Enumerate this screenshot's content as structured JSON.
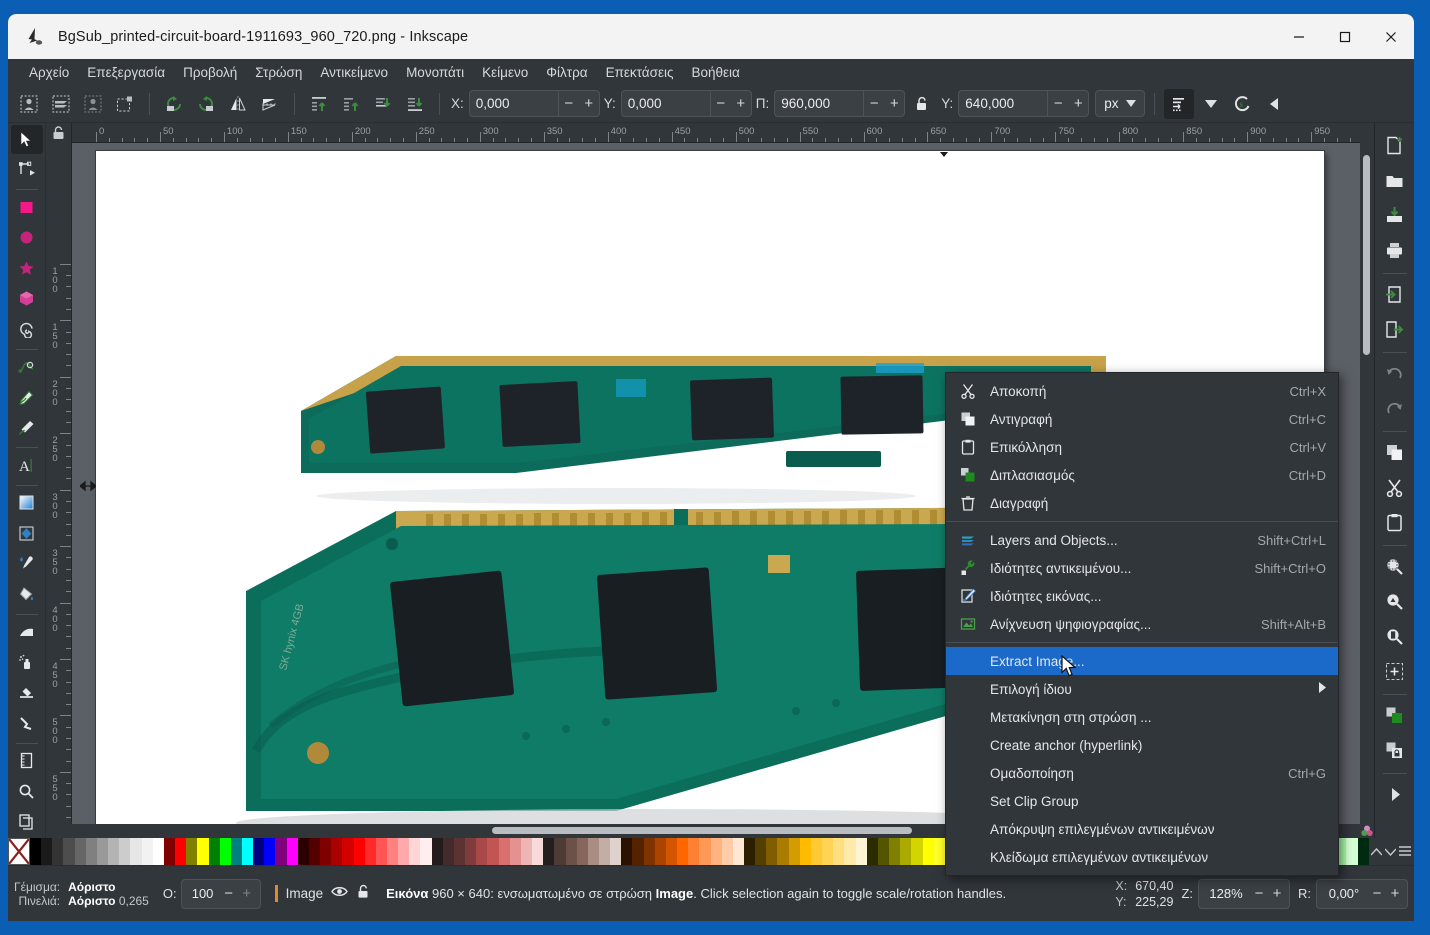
{
  "window": {
    "title": "BgSub_printed-circuit-board-1911693_960_720.png - Inkscape",
    "app_icon": "inkscape-icon",
    "minimize_label": "─",
    "maximize_label": "□",
    "close_label": "✕"
  },
  "menubar": {
    "items": [
      {
        "label": "Αρχείο",
        "name": "menu-file"
      },
      {
        "label": "Επεξεργασία",
        "name": "menu-edit"
      },
      {
        "label": "Προβολή",
        "name": "menu-view"
      },
      {
        "label": "Στρώση",
        "name": "menu-layer"
      },
      {
        "label": "Αντικείμενο",
        "name": "menu-object"
      },
      {
        "label": "Μονοπάτι",
        "name": "menu-path"
      },
      {
        "label": "Κείμενο",
        "name": "menu-text"
      },
      {
        "label": "Φίλτρα",
        "name": "menu-filters"
      },
      {
        "label": "Επεκτάσεις",
        "name": "menu-extensions"
      },
      {
        "label": "Βοήθεια",
        "name": "menu-help"
      }
    ]
  },
  "toolbar": {
    "select_all_label": "select-all-in-all-layers",
    "fields": [
      {
        "label": "X:",
        "value": "0,000",
        "name": "x-field"
      },
      {
        "label": "Y:",
        "value": "0,000",
        "name": "y-field"
      },
      {
        "label": "Π:",
        "value": "960,000",
        "name": "width-field"
      },
      {
        "label": "Y:",
        "value": "640,000",
        "name": "height-field"
      }
    ],
    "unit": "px",
    "minus": "−",
    "plus": "+"
  },
  "rulers": {
    "horizontal_ticks": [
      "0",
      "50",
      "100",
      "150",
      "200",
      "250",
      "300",
      "350",
      "400",
      "450",
      "500",
      "550",
      "600",
      "650",
      "700",
      "750",
      "800",
      "850",
      "900",
      "950"
    ],
    "vertical_ticks": [
      "100",
      "150",
      "200",
      "250",
      "300",
      "350",
      "400",
      "450",
      "500",
      "550"
    ]
  },
  "context_menu": {
    "items": [
      {
        "label": "Αποκοπή",
        "accel": "Ctrl+X",
        "icon": "scissors-icon",
        "name": "ctx-cut"
      },
      {
        "label": "Αντιγραφή",
        "accel": "Ctrl+C",
        "icon": "copy-icon",
        "name": "ctx-copy"
      },
      {
        "label": "Επικόλληση",
        "accel": "Ctrl+V",
        "icon": "clipboard-icon",
        "name": "ctx-paste"
      },
      {
        "label": "Διπλασιασμός",
        "accel": "Ctrl+D",
        "icon": "duplicate-icon",
        "name": "ctx-duplicate"
      },
      {
        "label": "Διαγραφή",
        "accel": "",
        "icon": "trash-icon",
        "name": "ctx-delete"
      },
      {
        "label": "Layers and Objects...",
        "accel": "Shift+Ctrl+L",
        "icon": "layers-icon",
        "name": "ctx-layers-and-objects"
      },
      {
        "label": "Ιδιότητες αντικειμένου...",
        "accel": "Shift+Ctrl+O",
        "icon": "wrench-icon",
        "name": "ctx-object-properties"
      },
      {
        "label": "Ιδιότητες εικόνας...",
        "accel": "",
        "icon": "image-edit-icon",
        "name": "ctx-image-properties"
      },
      {
        "label": "Ανίχνευση ψηφιογραφίας...",
        "accel": "Shift+Alt+B",
        "icon": "trace-bitmap-icon",
        "name": "ctx-trace-bitmap"
      },
      {
        "label": "Extract Image...",
        "accel": "",
        "icon": "",
        "name": "ctx-extract-image",
        "highlighted": true
      },
      {
        "label": "Επιλογή ίδιου",
        "accel": "",
        "icon": "",
        "submenu": true,
        "name": "ctx-select-same"
      },
      {
        "label": "Μετακίνηση στη στρώση ...",
        "accel": "",
        "icon": "",
        "name": "ctx-move-to-layer"
      },
      {
        "label": "Create anchor (hyperlink)",
        "accel": "",
        "icon": "",
        "name": "ctx-create-anchor"
      },
      {
        "label": "Ομαδοποίηση",
        "accel": "Ctrl+G",
        "icon": "",
        "name": "ctx-group"
      },
      {
        "label": "Set Clip Group",
        "accel": "",
        "icon": "",
        "name": "ctx-set-clip-group"
      },
      {
        "label": "Απόκρυψη επιλεγμένων αντικειμένων",
        "accel": "",
        "icon": "",
        "name": "ctx-hide-selected"
      },
      {
        "label": "Κλείδωμα επιλεγμένων αντικειμένων",
        "accel": "",
        "icon": "",
        "name": "ctx-lock-selected"
      }
    ]
  },
  "statusbar": {
    "fill_label": "Γέμισμα:",
    "fill_value": "Αόριστο",
    "stroke_label": "Πινελιά:",
    "stroke_value": "Αόριστο",
    "stroke_width": "0,265",
    "opacity_label": "O:",
    "opacity_value": "100",
    "layer_name": "Image",
    "message_prefix": "Εικόνα",
    "message_dims": "960 × 640:",
    "message_mid": "ενσωματωμένο σε στρώση",
    "message_layer": "Image",
    "message_tail": ". Click selection again to toggle scale/rotation handles.",
    "x_label": "X:",
    "x_value": "670,40",
    "y_label": "Y:",
    "y_value": "225,29",
    "zoom_label": "Z:",
    "zoom_value": "128%",
    "rotation_label": "R:",
    "rotation_value": "0,00°",
    "minus": "−",
    "plus": "+"
  },
  "palette": {
    "colors": [
      "#000000",
      "#1a1a1a",
      "#333333",
      "#4d4d4d",
      "#666666",
      "#808080",
      "#999999",
      "#b3b3b3",
      "#cccccc",
      "#e6e6e6",
      "#f2f2f2",
      "#ffffff",
      "#800000",
      "#ff0000",
      "#808000",
      "#ffff00",
      "#008000",
      "#00ff00",
      "#008080",
      "#00ffff",
      "#000080",
      "#0000ff",
      "#800080",
      "#ff00ff",
      "#2b0000",
      "#550000",
      "#800000",
      "#aa0000",
      "#d40000",
      "#ff0000",
      "#ff2a2a",
      "#ff5555",
      "#ff8080",
      "#ffaaaa",
      "#ffd5d5",
      "#ffeeee",
      "#241c1c",
      "#432b2b",
      "#5d3232",
      "#803c3c",
      "#a84848",
      "#c35454",
      "#d97070",
      "#e39191",
      "#efb4b4",
      "#f7dada",
      "#241f1f",
      "#4c3c35",
      "#6b5149",
      "#85655c",
      "#a98c82",
      "#c3ada5",
      "#dfd2cc",
      "#2b1100",
      "#552200",
      "#803300",
      "#aa4400",
      "#d45500",
      "#ff6600",
      "#ff8033",
      "#ff9955",
      "#ffb380",
      "#ffccaa",
      "#ffe6d5",
      "#2b1f00",
      "#553f00",
      "#805e00",
      "#aa7d00",
      "#d49c00",
      "#ffbb00",
      "#ffc933",
      "#ffd455",
      "#ffdf80",
      "#ffeaaa",
      "#fff4d5",
      "#2b2b00",
      "#555500",
      "#808000",
      "#aaaa00",
      "#d4d400",
      "#ffff00",
      "#ffff2a",
      "#ffff55",
      "#ffff80",
      "#ffffaa",
      "#ffffd5",
      "#1f2b00",
      "#3f5500",
      "#5e8000",
      "#7daa00",
      "#9cd400",
      "#bbff00",
      "#c9ff33",
      "#d4ff55",
      "#dfff80",
      "#eaffaa",
      "#f4ffd5",
      "#112b00",
      "#225500",
      "#338000",
      "#44aa00",
      "#55d400",
      "#66ff00",
      "#80ff33",
      "#99ff55",
      "#b3ff80",
      "#ccffaa",
      "#e6ffd5",
      "#002b00",
      "#005500",
      "#008000",
      "#00aa00",
      "#00d400",
      "#00ff00",
      "#2aff2a",
      "#55ff55",
      "#80ff80",
      "#aaffaa",
      "#d5ffd5",
      "#002b11"
    ]
  },
  "left_tools": [
    {
      "name": "tool-selector",
      "icon": "arrow-cursor-icon",
      "selected": true
    },
    {
      "name": "tool-node-editor",
      "icon": "node-editor-icon"
    },
    {
      "name": "tool-rectangle",
      "icon": "rectangle-icon"
    },
    {
      "name": "tool-ellipse",
      "icon": "ellipse-icon"
    },
    {
      "name": "tool-star",
      "icon": "star-icon"
    },
    {
      "name": "tool-3dbox",
      "icon": "cube-icon"
    },
    {
      "name": "tool-spiral",
      "icon": "spiral-icon"
    },
    {
      "name": "tool-bezier",
      "icon": "bezier-pen-icon"
    },
    {
      "name": "tool-pencil",
      "icon": "pencil-icon"
    },
    {
      "name": "tool-calligraphy",
      "icon": "calligraphy-brush-icon"
    },
    {
      "name": "tool-text",
      "icon": "text-icon"
    },
    {
      "name": "tool-gradient",
      "icon": "gradient-icon"
    },
    {
      "name": "tool-mesh",
      "icon": "mesh-gradient-icon"
    },
    {
      "name": "tool-dropper",
      "icon": "eyedropper-icon"
    },
    {
      "name": "tool-paintbucket",
      "icon": "paint-bucket-icon"
    },
    {
      "name": "tool-tweak",
      "icon": "tweak-icon"
    },
    {
      "name": "tool-spray",
      "icon": "spray-icon"
    },
    {
      "name": "tool-eraser",
      "icon": "eraser-icon"
    },
    {
      "name": "tool-connector",
      "icon": "connector-icon"
    },
    {
      "name": "tool-measure",
      "icon": "measure-icon"
    },
    {
      "name": "tool-zoom",
      "icon": "magnifier-icon"
    },
    {
      "name": "tool-pages",
      "icon": "pages-icon"
    }
  ],
  "right_dock": [
    {
      "name": "dock-new",
      "icon": "new-document-icon"
    },
    {
      "name": "dock-open",
      "icon": "folder-open-icon"
    },
    {
      "name": "dock-save",
      "icon": "save-icon"
    },
    {
      "name": "dock-print",
      "icon": "printer-icon"
    },
    {
      "name": "dock-import",
      "icon": "import-icon"
    },
    {
      "name": "dock-export",
      "icon": "export-icon"
    },
    {
      "name": "dock-undo",
      "icon": "undo-icon"
    },
    {
      "name": "dock-redo",
      "icon": "redo-icon"
    },
    {
      "name": "dock-copy",
      "icon": "copy-icon"
    },
    {
      "name": "dock-cut",
      "icon": "scissors-icon"
    },
    {
      "name": "dock-paste",
      "icon": "clipboard-icon"
    },
    {
      "name": "dock-zoom-selection",
      "icon": "zoom-selection-icon"
    },
    {
      "name": "dock-zoom-drawing",
      "icon": "zoom-drawing-icon"
    },
    {
      "name": "dock-zoom-page",
      "icon": "zoom-page-icon"
    },
    {
      "name": "dock-group-select",
      "icon": "select-all-icon"
    },
    {
      "name": "dock-duplicate",
      "icon": "duplicate-icon"
    },
    {
      "name": "dock-clone",
      "icon": "clone-icon"
    },
    {
      "name": "dock-expand",
      "icon": "chevron-right-icon"
    }
  ]
}
